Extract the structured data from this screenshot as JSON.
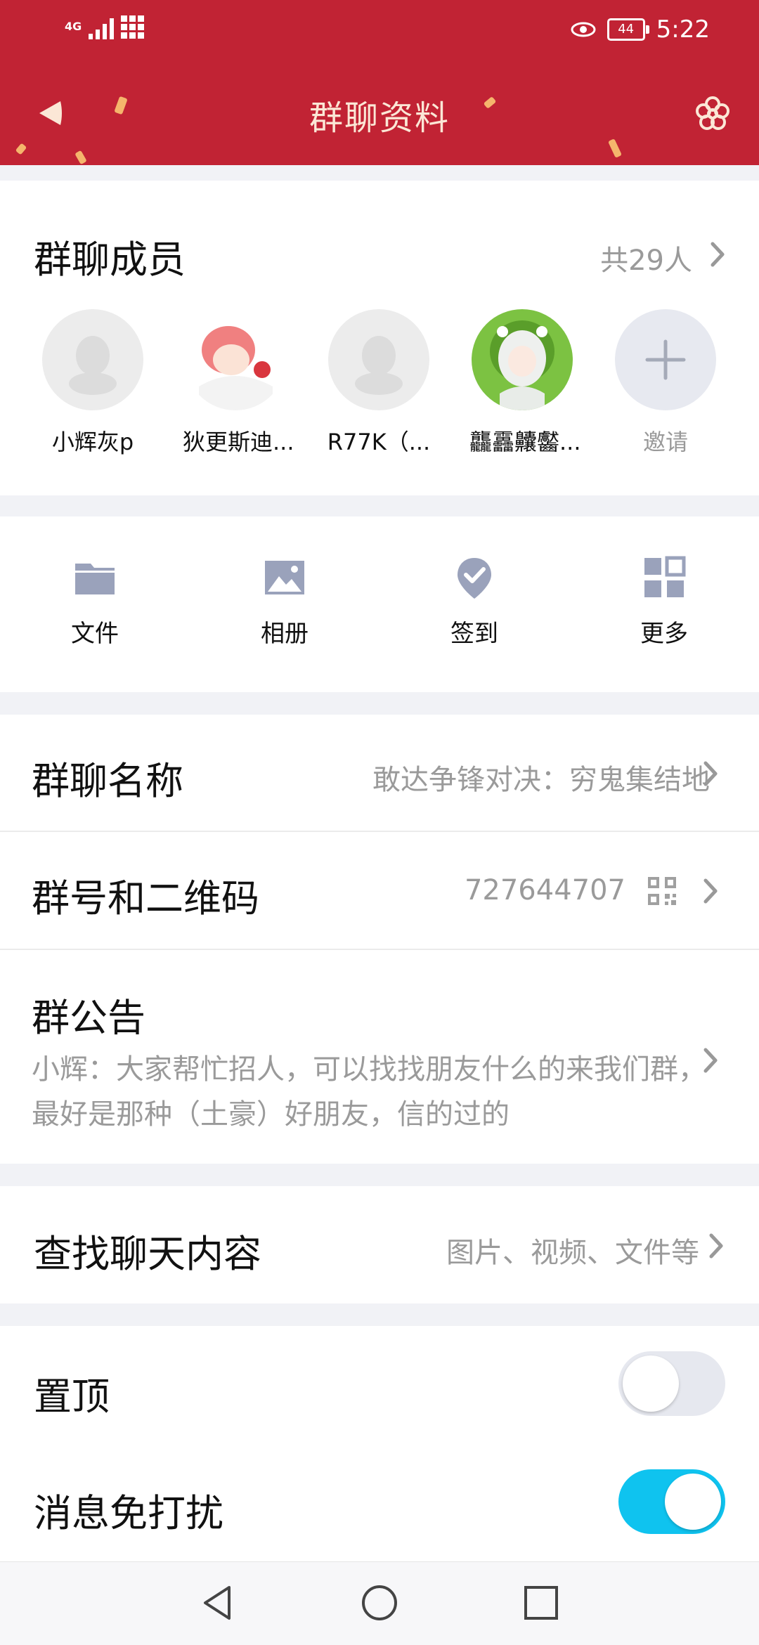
{
  "status_bar": {
    "network": "4G",
    "battery": "44",
    "time": "5:22"
  },
  "header": {
    "title": "群聊资料"
  },
  "members": {
    "title": "群聊成员",
    "count": "共29人",
    "list": [
      {
        "name": "小辉灰p"
      },
      {
        "name": "狄更斯迪..."
      },
      {
        "name": "R77K（..."
      },
      {
        "name": "龘靐齉齾..."
      }
    ],
    "invite_label": "邀请"
  },
  "actions": [
    {
      "label": "文件",
      "icon": "folder-icon"
    },
    {
      "label": "相册",
      "icon": "image-icon"
    },
    {
      "label": "签到",
      "icon": "checkin-icon"
    },
    {
      "label": "更多",
      "icon": "apps-icon"
    }
  ],
  "group_name": {
    "label": "群聊名称",
    "value": "敢达争锋对决：穷鬼集结地"
  },
  "group_id": {
    "label": "群号和二维码",
    "value": "727644707"
  },
  "announcement": {
    "label": "群公告",
    "text": "小辉：大家帮忙招人，可以找找朋友什么的来我们群，最好是那种（土豪）好朋友，信的过的"
  },
  "search_chat": {
    "label": "查找聊天内容",
    "value": "图片、视频、文件等"
  },
  "pin_top": {
    "label": "置顶",
    "on": false
  },
  "mute": {
    "label": "消息免打扰",
    "on": true
  },
  "colors": {
    "header_bg": "#c12334",
    "toggle_on": "#0fc3ef",
    "toggle_off": "#e6e8ef"
  }
}
